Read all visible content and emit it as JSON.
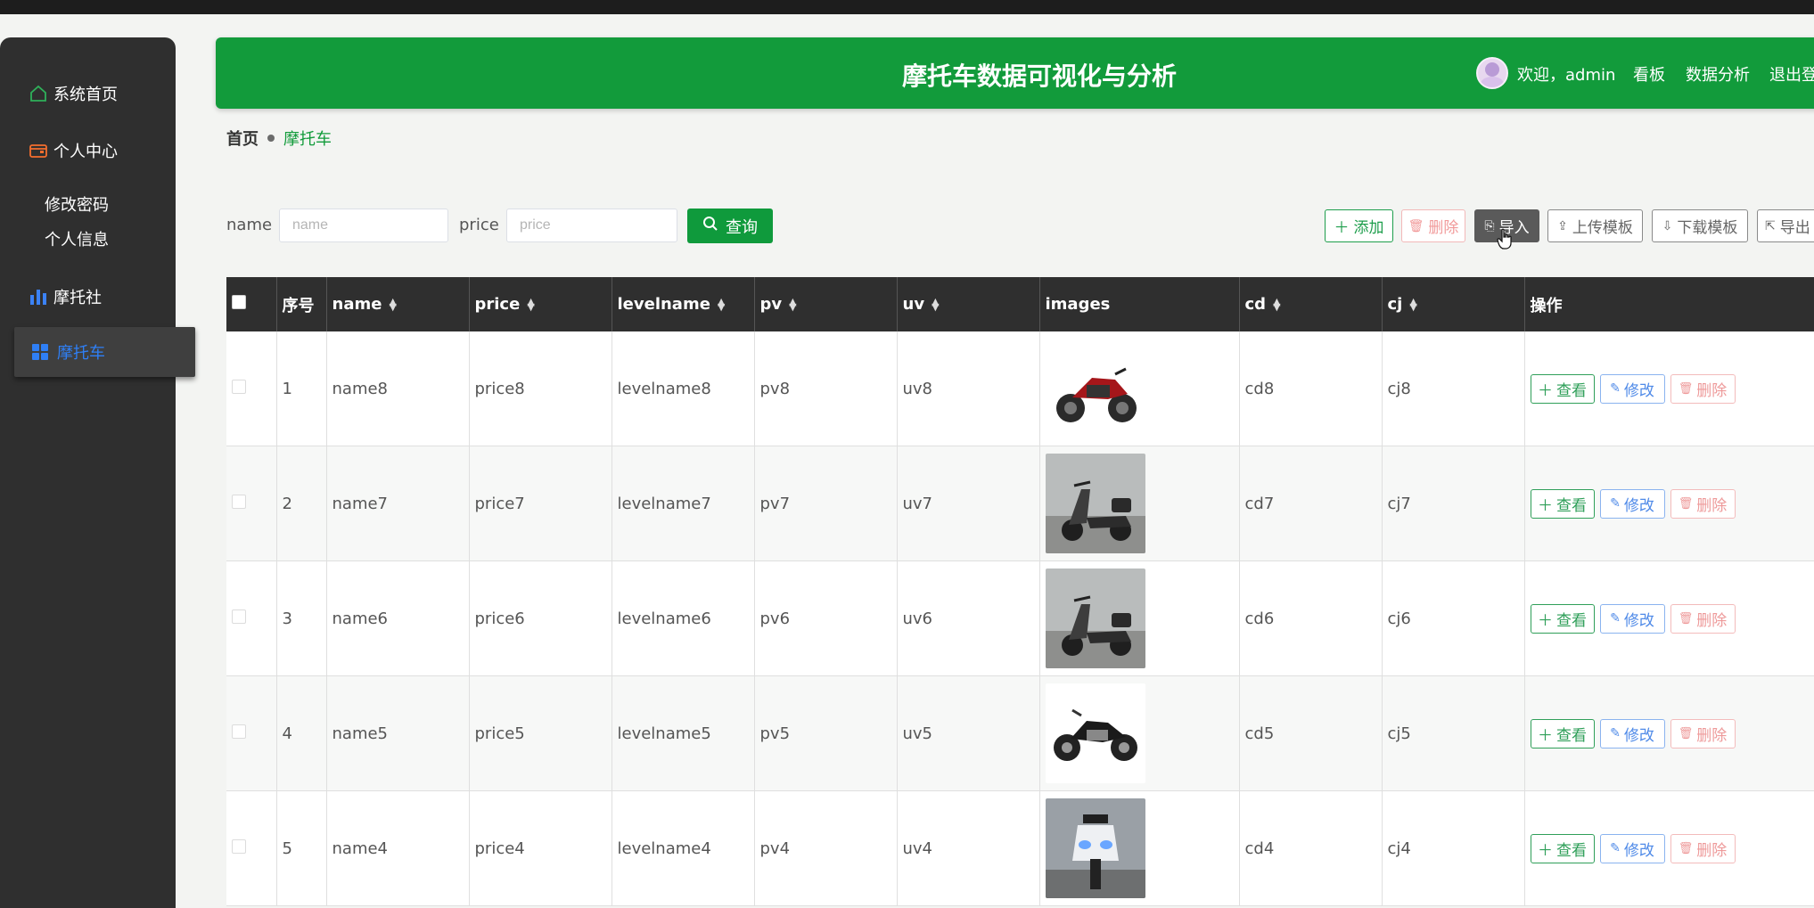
{
  "header": {
    "title": "摩托车数据可视化与分析",
    "welcome": "欢迎，admin",
    "links": [
      "看板",
      "数据分析",
      "退出登"
    ]
  },
  "sidebar": {
    "items": [
      {
        "label": "系统首页",
        "icon": "home-icon",
        "color": "#2fb15a"
      },
      {
        "label": "个人中心",
        "icon": "wallet-icon",
        "color": "#f56e2e"
      },
      {
        "label": "修改密码"
      },
      {
        "label": "个人信息"
      },
      {
        "label": "摩托社",
        "icon": "bar-chart-icon",
        "color": "#3b82f6"
      },
      {
        "label": "摩托车",
        "icon": "grid-icon",
        "color": "#2f7ff5",
        "active": true
      }
    ]
  },
  "breadcrumb": {
    "home": "首页",
    "current": "摩托车"
  },
  "search": {
    "name_label": "name",
    "name_placeholder": "name",
    "price_label": "price",
    "price_placeholder": "price",
    "query_label": "查询"
  },
  "toolbar": {
    "add": "添加",
    "delete": "删除",
    "import": "导入",
    "upload_template": "上传模板",
    "download_template": "下载模板",
    "export": "导出"
  },
  "table": {
    "columns": [
      "序号",
      "name",
      "price",
      "levelname",
      "pv",
      "uv",
      "images",
      "cd",
      "cj",
      "操作"
    ],
    "rows": [
      {
        "idx": "1",
        "name": "name8",
        "price": "price8",
        "levelname": "levelname8",
        "pv": "pv8",
        "uv": "uv8",
        "cd": "cd8",
        "cj": "cj8",
        "image": "red-motorcycle"
      },
      {
        "idx": "2",
        "name": "name7",
        "price": "price7",
        "levelname": "levelname7",
        "pv": "pv7",
        "uv": "uv7",
        "cd": "cd7",
        "cj": "cj7",
        "image": "scooter-grey"
      },
      {
        "idx": "3",
        "name": "name6",
        "price": "price6",
        "levelname": "levelname6",
        "pv": "pv6",
        "uv": "uv6",
        "cd": "cd6",
        "cj": "cj6",
        "image": "scooter-grey"
      },
      {
        "idx": "4",
        "name": "name5",
        "price": "price5",
        "levelname": "levelname5",
        "pv": "pv5",
        "uv": "uv5",
        "cd": "cd5",
        "cj": "cj5",
        "image": "black-cruiser"
      },
      {
        "idx": "5",
        "name": "name4",
        "price": "price4",
        "levelname": "levelname4",
        "pv": "pv4",
        "uv": "uv4",
        "cd": "cd4",
        "cj": "cj4",
        "image": "white-sport"
      }
    ],
    "actions": {
      "view": "查看",
      "edit": "修改",
      "delete": "删除"
    }
  },
  "colors": {
    "primary_green": "#129b3b",
    "sidebar_bg": "#2f2f2f",
    "table_header_bg": "#2f2f2f",
    "active_blue": "#2f7ff5"
  }
}
